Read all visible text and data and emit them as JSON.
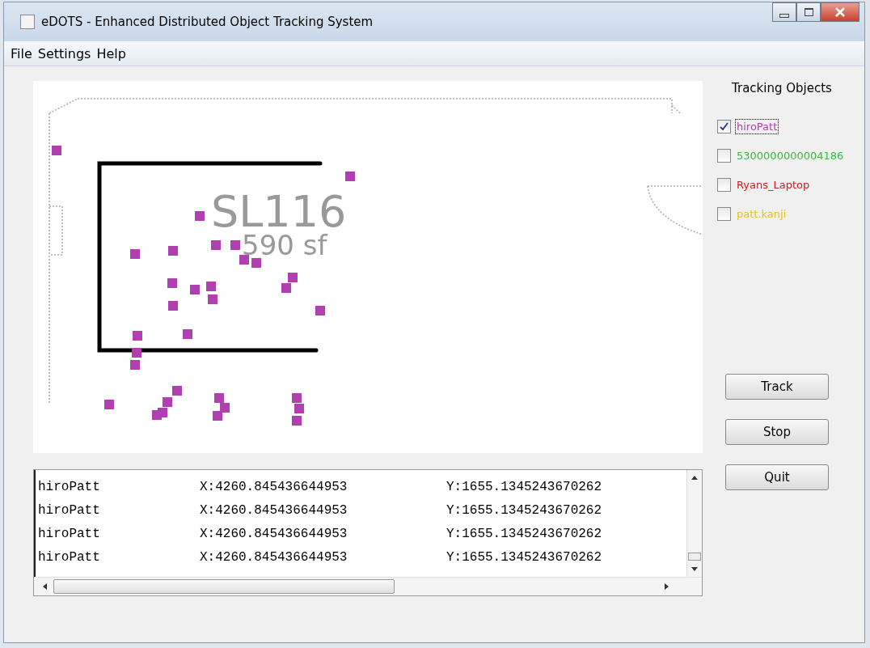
{
  "window": {
    "title": "eDOTS - Enhanced Distributed Object Tracking System"
  },
  "menu": [
    "File",
    "Settings",
    "Help"
  ],
  "map": {
    "room_label": "SL116",
    "area_label": "590 sf"
  },
  "tracking": {
    "title": "Tracking Objects",
    "objects": [
      {
        "name": "hiroPatt",
        "checked": true,
        "color": "#b040b0"
      },
      {
        "name": "5300000000004186",
        "checked": false,
        "color": "#3cb83c"
      },
      {
        "name": "Ryans_Laptop",
        "checked": false,
        "color": "#cc2020"
      },
      {
        "name": "patt.kanji",
        "checked": false,
        "color": "#e8c020"
      }
    ]
  },
  "log": [
    {
      "name": "hiroPatt",
      "x": "X:4260.845436644953",
      "y": "Y:1655.1345243670262"
    },
    {
      "name": "hiroPatt",
      "x": "X:4260.845436644953",
      "y": "Y:1655.1345243670262"
    },
    {
      "name": "hiroPatt",
      "x": "X:4260.845436644953",
      "y": "Y:1655.1345243670262"
    },
    {
      "name": "hiroPatt",
      "x": "X:4260.845436644953",
      "y": "Y:1655.1345243670262"
    }
  ],
  "buttons": [
    "Track",
    "Stop",
    "Quit"
  ]
}
